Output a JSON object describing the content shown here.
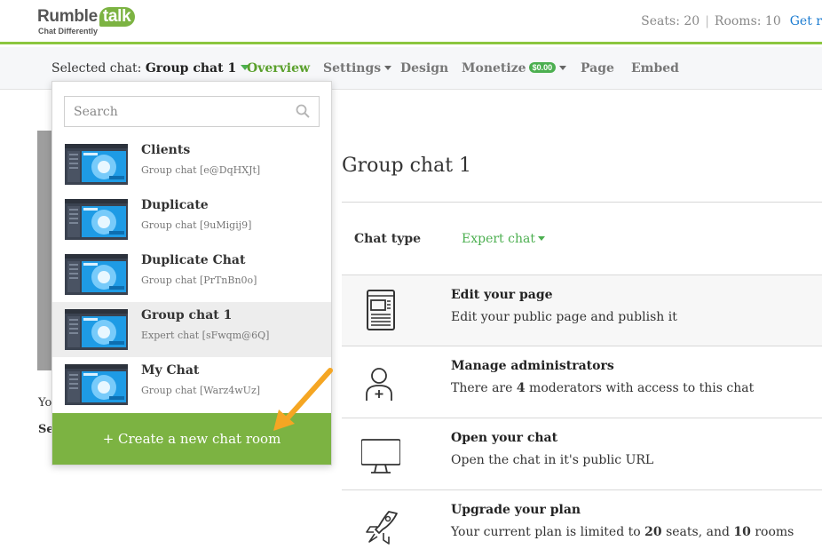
{
  "header": {
    "logo_main": "Rumble",
    "logo_talk": "talk",
    "logo_tagline": "Chat Differently",
    "seats": "Seats: 20",
    "rooms": "Rooms: 10",
    "cta": "Get r"
  },
  "nav": {
    "selected_label": "Selected chat:",
    "selected_value": "Group chat 1",
    "overview": "Overview",
    "settings": "Settings",
    "design": "Design",
    "monetize": "Monetize",
    "monetize_badge": "$0.00",
    "page": "Page",
    "embed": "Embed"
  },
  "dropdown": {
    "search_placeholder": "Search",
    "items": [
      {
        "name": "Clients",
        "sub": "Group chat [e@DqHXJt]"
      },
      {
        "name": "Duplicate",
        "sub": "Group chat [9uMigij9]"
      },
      {
        "name": "Duplicate Chat",
        "sub": "Group chat [PrTnBn0o]"
      },
      {
        "name": "Group chat 1",
        "sub": "Expert chat [sFwqm@6Q]",
        "selected": true
      },
      {
        "name": "My Chat",
        "sub": "Group chat [Warz4wUz]"
      }
    ],
    "create_button": "+ Create a new chat room"
  },
  "background": {
    "text1": "Yo",
    "text2": "Se"
  },
  "main": {
    "room_title": "Group chat 1",
    "chat_type_label": "Chat type",
    "chat_type_value": "Expert chat",
    "rows": [
      {
        "icon": "page-icon",
        "title": "Edit your page",
        "desc": "Edit your public page and publish it"
      },
      {
        "icon": "admin-icon",
        "title": "Manage administrators",
        "desc_pre": "There are ",
        "desc_num": "4",
        "desc_post": " moderators with access to this chat"
      },
      {
        "icon": "monitor-icon",
        "title": "Open your chat",
        "desc": "Open the chat in it's public URL"
      },
      {
        "icon": "rocket-icon",
        "title": "Upgrade your plan",
        "desc_pre": "Your current plan is limited to ",
        "desc_num1": "20",
        "desc_mid": " seats, and ",
        "desc_num2": "10",
        "desc_post": " rooms"
      }
    ]
  },
  "colors": {
    "brand_green": "#7cb342",
    "active_green": "#5aa02c",
    "link_blue": "#1a7bd1",
    "annotation_arrow": "#f5a623"
  }
}
